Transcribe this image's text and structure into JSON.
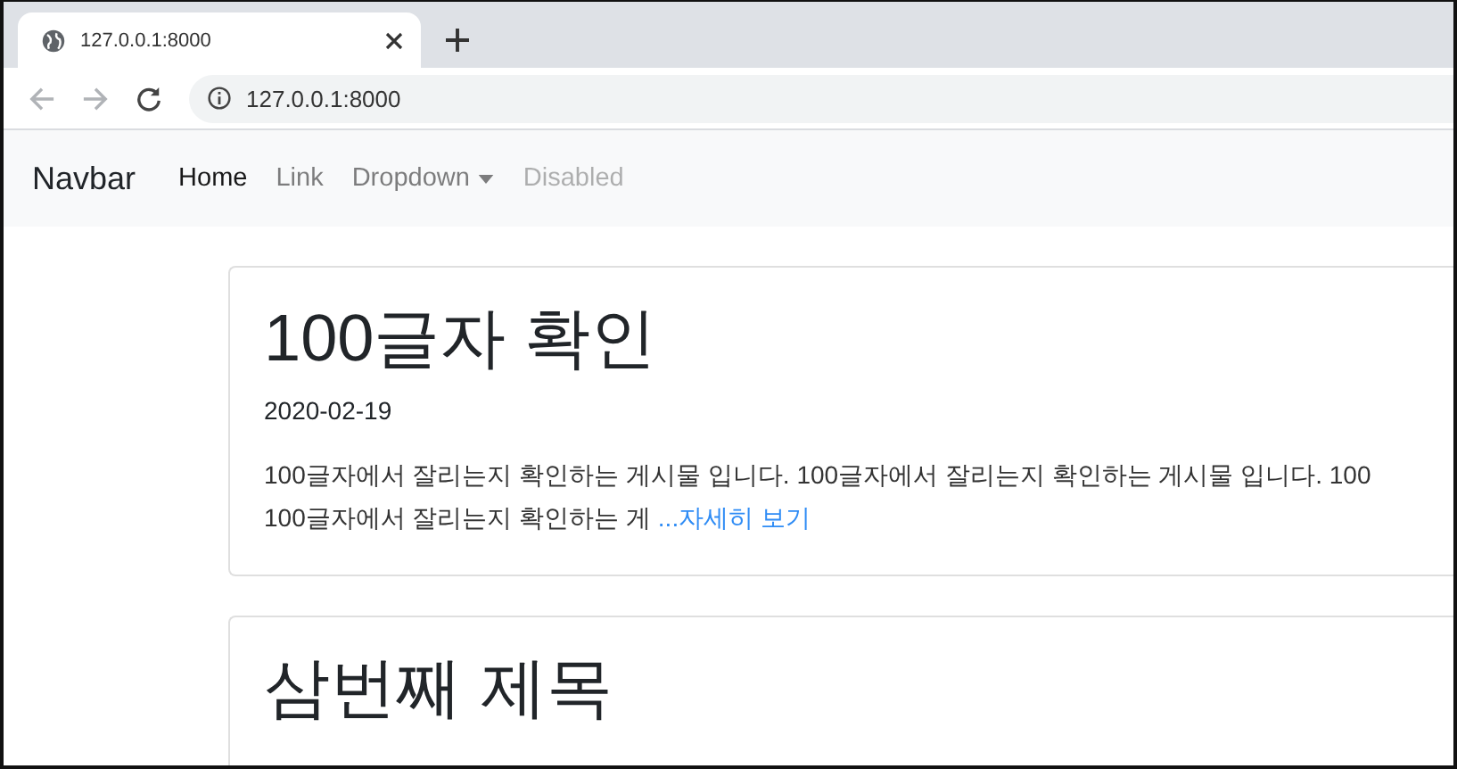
{
  "browser": {
    "tab_title": "127.0.0.1:8000",
    "address": "127.0.0.1:8000"
  },
  "navbar": {
    "brand": "Navbar",
    "items": [
      {
        "label": "Home",
        "selected": true,
        "disabled": false,
        "kind": "link"
      },
      {
        "label": "Link",
        "selected": false,
        "disabled": false,
        "kind": "link"
      },
      {
        "label": "Dropdown",
        "selected": false,
        "disabled": false,
        "kind": "dropdown"
      },
      {
        "label": "Disabled",
        "selected": false,
        "disabled": true,
        "kind": "link"
      }
    ]
  },
  "posts": [
    {
      "title": "100글자 확인",
      "date": "2020-02-19",
      "excerpt_lines": [
        "100글자에서 잘리는지 확인하는 게시물 입니다. 100글자에서 잘리는지 확인하는 게시물 입니다. 100",
        "100글자에서 잘리는지 확인하는 게"
      ],
      "more_link": "...자세히 보기"
    },
    {
      "title": "삼번째 제목"
    }
  ]
}
